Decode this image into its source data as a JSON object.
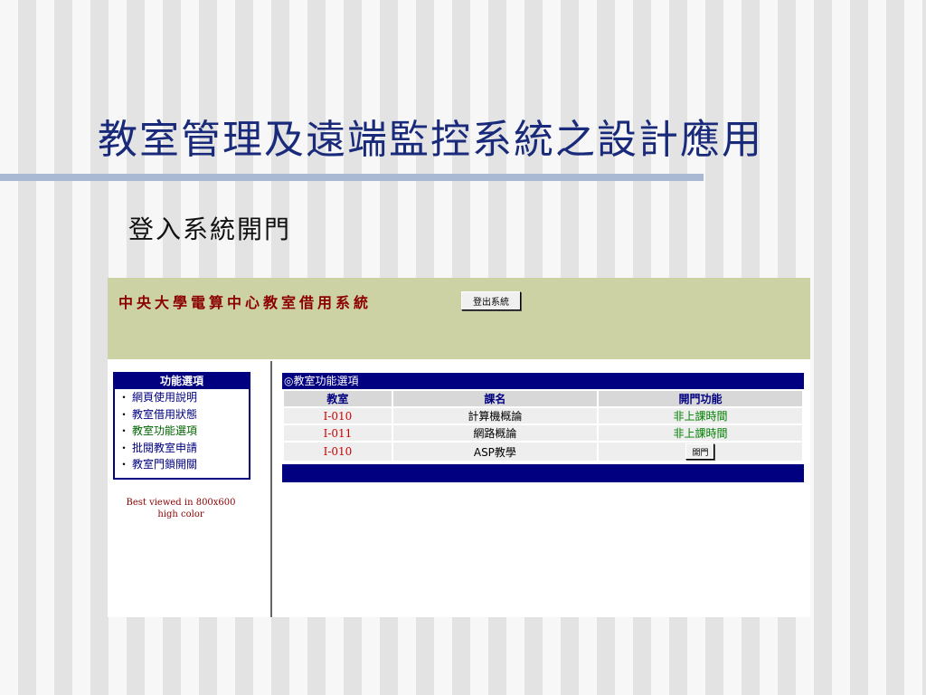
{
  "slide": {
    "title": "教室管理及遠端監控系統之設計應用",
    "subtitle": "登入系統開門"
  },
  "app": {
    "title": "中央大學電算中心教室借用系統",
    "logout_label": "登出系統",
    "colors": {
      "header_bg": "#cdd2a5",
      "navy": "#000080",
      "title_red": "#8b0000"
    }
  },
  "sidebar": {
    "header": "功能選項",
    "items": [
      {
        "label": "網頁使用說明"
      },
      {
        "label": "教室借用狀態"
      },
      {
        "label": "教室功能選項"
      },
      {
        "label": "批閱教室申請"
      },
      {
        "label": "教室門鎖開關"
      }
    ],
    "best_viewed_line1": "Best viewed in 800x600",
    "best_viewed_line2": "high color"
  },
  "content": {
    "header": "◎教室功能選項",
    "columns": [
      "教室",
      "課名",
      "開門功能"
    ],
    "rows": [
      {
        "room": "I-010",
        "course": "計算機概論",
        "action": "非上課時間"
      },
      {
        "room": "I-011",
        "course": "網路概論",
        "action": "非上課時間"
      },
      {
        "room": "I-010",
        "course": "ASP教學",
        "action_button": "開門"
      }
    ]
  }
}
